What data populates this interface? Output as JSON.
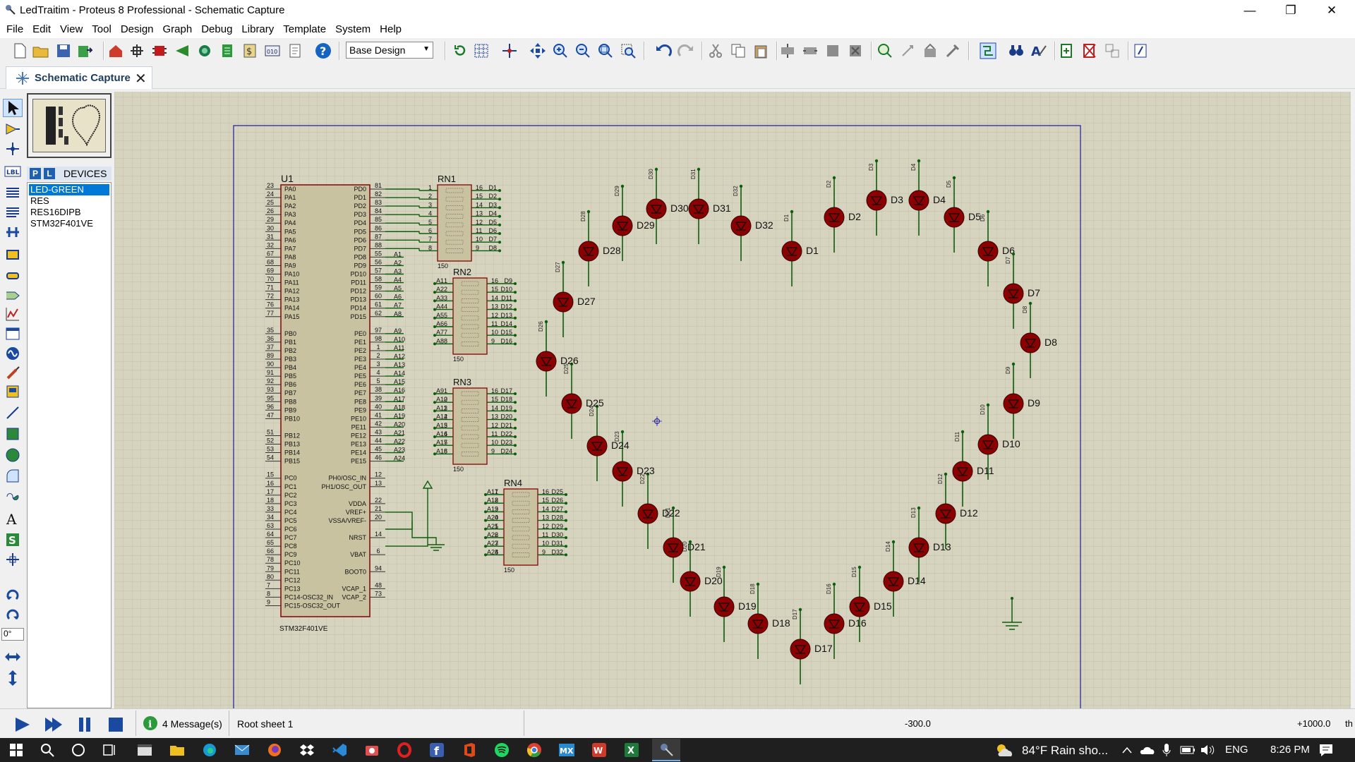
{
  "window": {
    "title": "LedTraitim - Proteus 8 Professional - Schematic Capture",
    "minimize": "—",
    "restore": "❐",
    "close": "✕"
  },
  "menu": [
    "File",
    "Edit",
    "View",
    "Tool",
    "Design",
    "Graph",
    "Debug",
    "Library",
    "Template",
    "System",
    "Help"
  ],
  "toolbar": {
    "design_select": "Base Design"
  },
  "tab": {
    "label": "Schematic Capture",
    "close": "✕"
  },
  "devices": {
    "p_button": "P",
    "l_button": "L",
    "header": "DEVICES",
    "items": [
      "LED-GREEN",
      "RES",
      "RES16DIPB",
      "STM32F401VE"
    ],
    "selected_index": 0
  },
  "rotation_value": "0°",
  "schematic": {
    "mcu_ref": "U1",
    "mcu_part": "STM32F401VE",
    "left_pins": [
      [
        "23",
        "PA0"
      ],
      [
        "24",
        "PA1"
      ],
      [
        "25",
        "PA2"
      ],
      [
        "26",
        "PA3"
      ],
      [
        "29",
        "PA4"
      ],
      [
        "30",
        "PA5"
      ],
      [
        "31",
        "PA6"
      ],
      [
        "32",
        "PA7"
      ],
      [
        "67",
        "PA8"
      ],
      [
        "68",
        "PA9"
      ],
      [
        "69",
        "PA10"
      ],
      [
        "70",
        "PA11"
      ],
      [
        "71",
        "PA12"
      ],
      [
        "72",
        "PA13"
      ],
      [
        "76",
        "PA14"
      ],
      [
        "77",
        "PA15"
      ],
      [
        "",
        ""
      ],
      [
        "35",
        "PB0"
      ],
      [
        "36",
        "PB1"
      ],
      [
        "37",
        "PB2"
      ],
      [
        "89",
        "PB3"
      ],
      [
        "90",
        "PB4"
      ],
      [
        "91",
        "PB5"
      ],
      [
        "92",
        "PB6"
      ],
      [
        "93",
        "PB7"
      ],
      [
        "95",
        "PB8"
      ],
      [
        "96",
        "PB9"
      ],
      [
        "47",
        "PB10"
      ],
      [
        "",
        ""
      ],
      [
        "51",
        "PB12"
      ],
      [
        "52",
        "PB13"
      ],
      [
        "53",
        "PB14"
      ],
      [
        "54",
        "PB15"
      ],
      [
        "",
        ""
      ],
      [
        "15",
        "PC0"
      ],
      [
        "16",
        "PC1"
      ],
      [
        "17",
        "PC2"
      ],
      [
        "18",
        "PC3"
      ],
      [
        "33",
        "PC4"
      ],
      [
        "34",
        "PC5"
      ],
      [
        "63",
        "PC6"
      ],
      [
        "64",
        "PC7"
      ],
      [
        "65",
        "PC8"
      ],
      [
        "66",
        "PC9"
      ],
      [
        "78",
        "PC10"
      ],
      [
        "79",
        "PC11"
      ],
      [
        "80",
        "PC12"
      ],
      [
        "7",
        "PC13"
      ],
      [
        "8",
        "PC14-OSC32_IN"
      ],
      [
        "9",
        "PC15-OSC32_OUT"
      ]
    ],
    "right_pins": [
      [
        "81",
        "PD0"
      ],
      [
        "82",
        "PD1"
      ],
      [
        "83",
        "PD2"
      ],
      [
        "84",
        "PD3"
      ],
      [
        "85",
        "PD4"
      ],
      [
        "86",
        "PD5"
      ],
      [
        "87",
        "PD6"
      ],
      [
        "88",
        "PD7"
      ],
      [
        "55",
        "PD8"
      ],
      [
        "56",
        "PD9"
      ],
      [
        "57",
        "PD10"
      ],
      [
        "58",
        "PD11"
      ],
      [
        "59",
        "PD12"
      ],
      [
        "60",
        "PD13"
      ],
      [
        "61",
        "PD14"
      ],
      [
        "62",
        "PD15"
      ],
      [
        "",
        ""
      ],
      [
        "97",
        "PE0"
      ],
      [
        "98",
        "PE1"
      ],
      [
        "1",
        "PE2"
      ],
      [
        "2",
        "PE3"
      ],
      [
        "3",
        "PE4"
      ],
      [
        "4",
        "PE5"
      ],
      [
        "5",
        "PE6"
      ],
      [
        "38",
        "PE7"
      ],
      [
        "39",
        "PE8"
      ],
      [
        "40",
        "PE9"
      ],
      [
        "41",
        "PE10"
      ],
      [
        "42",
        "PE11"
      ],
      [
        "43",
        "PE12"
      ],
      [
        "44",
        "PE13"
      ],
      [
        "45",
        "PE14"
      ],
      [
        "46",
        "PE15"
      ],
      [
        "",
        ""
      ],
      [
        "12",
        "PH0/OSC_IN"
      ],
      [
        "13",
        "PH1/OSC_OUT"
      ],
      [
        "",
        ""
      ],
      [
        "22",
        "VDDA"
      ],
      [
        "21",
        "VREF+"
      ],
      [
        "20",
        "VSSA/VREF-"
      ],
      [
        "",
        ""
      ],
      [
        "14",
        "NRST"
      ],
      [
        "",
        ""
      ],
      [
        "6",
        "VBAT"
      ],
      [
        "",
        ""
      ],
      [
        "94",
        "BOOT0"
      ],
      [
        "",
        ""
      ],
      [
        "48",
        "VCAP_1"
      ],
      [
        "73",
        "VCAP_2"
      ]
    ],
    "resnets": [
      {
        "ref": "RN1",
        "value": "150",
        "in": [
          "1",
          "2",
          "3",
          "4",
          "5",
          "6",
          "7",
          "8"
        ],
        "out": [
          "16",
          "15",
          "14",
          "13",
          "12",
          "11",
          "10",
          "9"
        ],
        "innet": [
          "",
          "",
          "",
          "",
          "",
          "",
          "",
          ""
        ],
        "outnet": [
          "D1",
          "D2",
          "D3",
          "D4",
          "D5",
          "D6",
          "D7",
          "D8"
        ]
      },
      {
        "ref": "RN2",
        "value": "150",
        "in": [
          "1",
          "2",
          "3",
          "4",
          "5",
          "6",
          "7",
          "8"
        ],
        "out": [
          "16",
          "15",
          "14",
          "13",
          "12",
          "11",
          "10",
          "9"
        ],
        "innet": [
          "A1",
          "A2",
          "A3",
          "A4",
          "A5",
          "A6",
          "A7",
          "A8"
        ],
        "outnet": [
          "D9",
          "D10",
          "D11",
          "D12",
          "D13",
          "D14",
          "D15",
          "D16"
        ]
      },
      {
        "ref": "RN3",
        "value": "150",
        "in": [
          "1",
          "2",
          "3",
          "4",
          "5",
          "6",
          "7",
          "8"
        ],
        "out": [
          "16",
          "15",
          "14",
          "13",
          "12",
          "11",
          "10",
          "9"
        ],
        "innet": [
          "A9",
          "A10",
          "A11",
          "A12",
          "A13",
          "A14",
          "A15",
          "A16"
        ],
        "outnet": [
          "D17",
          "D18",
          "D19",
          "D20",
          "D21",
          "D22",
          "D23",
          "D24"
        ]
      },
      {
        "ref": "RN4",
        "value": "150",
        "in": [
          "1",
          "2",
          "3",
          "4",
          "5",
          "6",
          "7",
          "8"
        ],
        "out": [
          "16",
          "15",
          "14",
          "13",
          "12",
          "11",
          "10",
          "9"
        ],
        "innet": [
          "A17",
          "A18",
          "A19",
          "A20",
          "A21",
          "A22",
          "A23",
          "A24"
        ],
        "outnet": [
          "D25",
          "D26",
          "D27",
          "D28",
          "D29",
          "D30",
          "D31",
          "D32"
        ]
      }
    ],
    "pd_nets": [
      "A1",
      "A2",
      "A3",
      "A4",
      "A5",
      "A6",
      "A7",
      "A8"
    ],
    "pe_nets": [
      "A9",
      "A10",
      "A11",
      "A12",
      "A13",
      "A14",
      "A15",
      "A16",
      "A17",
      "A18",
      "A19",
      "A20",
      "A21",
      "A22",
      "A23",
      "A24"
    ],
    "leds": [
      "D1",
      "D2",
      "D3",
      "D4",
      "D5",
      "D6",
      "D7",
      "D8",
      "D9",
      "D10",
      "D11",
      "D12",
      "D13",
      "D14",
      "D15",
      "D16",
      "D17",
      "D18",
      "D19",
      "D20",
      "D21",
      "D22",
      "D23",
      "D24",
      "D25",
      "D26",
      "D27",
      "D28",
      "D29",
      "D30",
      "D31",
      "D32"
    ]
  },
  "status": {
    "messages": "4 Message(s)",
    "sheet": "Root sheet 1",
    "coord_x": "-300.0",
    "coord_y": "+1000.0",
    "units": "th"
  },
  "taskbar": {
    "weather": "84°F  Rain sho...",
    "lang": "ENG",
    "time": "8:26 PM"
  },
  "colors": {
    "canvas_bg": "#d6d3be",
    "grid": "#bcbaa5",
    "sheet_border": "#1a1aa0",
    "component_fill": "#c9c2a1",
    "component_border": "#8a1010",
    "wire": "#0b5e0b",
    "led_body": "#8b0000",
    "selection": "#0078d7"
  }
}
